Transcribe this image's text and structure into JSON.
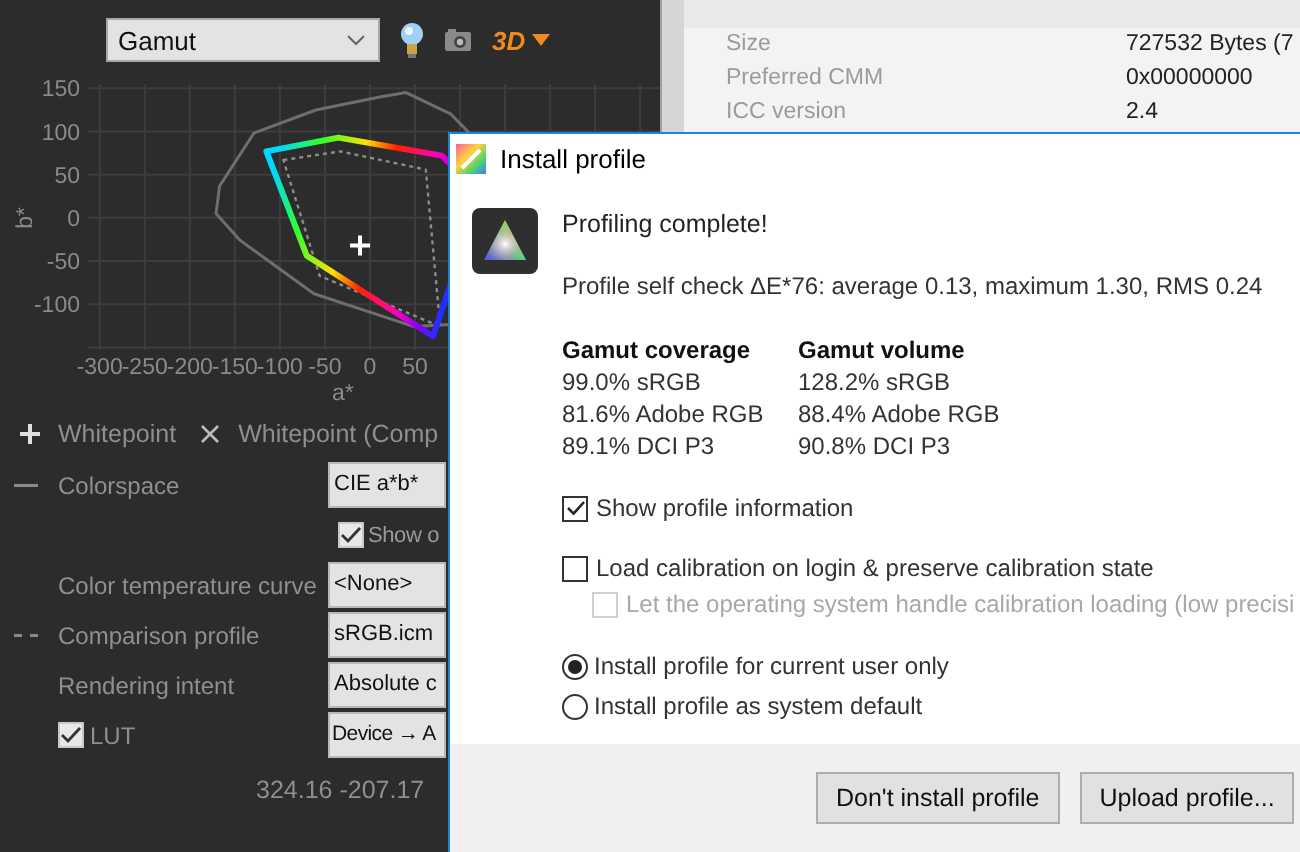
{
  "toolbar": {
    "view_select": {
      "value": "Gamut"
    },
    "mode_label": "3D"
  },
  "gamut_plot": {
    "x_axis_label": "a*",
    "y_axis_label": "b*",
    "x_tick_labels": [
      "-300",
      "-250",
      "-200",
      "-150",
      "-100",
      "-50",
      "0",
      "50"
    ],
    "y_tick_labels": [
      "150",
      "100",
      "50",
      "0",
      "-50",
      "-100"
    ]
  },
  "legend": [
    {
      "kind": "plus",
      "label": "Whitepoint"
    },
    {
      "kind": "cross",
      "label": "Whitepoint (Comp"
    }
  ],
  "settings": [
    {
      "kind": "dropdown",
      "label": "Colorspace",
      "line_marker": true,
      "dashed": false,
      "value": "CIE a*b*"
    },
    {
      "kind": "checkbox",
      "label": "Show o",
      "checked": true
    },
    {
      "kind": "dropdown",
      "label": "Color temperature curve",
      "value": "<None>"
    },
    {
      "kind": "dropdown",
      "label": "Comparison profile",
      "line_marker": true,
      "dashed": true,
      "value": "sRGB.icm"
    },
    {
      "kind": "dropdown",
      "label": "Rendering intent",
      "value": "Absolute c"
    },
    {
      "kind": "checkbox-dropdown",
      "label": "LUT",
      "checked": true,
      "value": "Device → A"
    }
  ],
  "cursor_readout": "324.16 -207.17",
  "profile_info": [
    {
      "name": "Size",
      "value": "727532 Bytes (7"
    },
    {
      "name": "Preferred CMM",
      "value": "0x00000000"
    },
    {
      "name": "ICC version",
      "value": "2.4"
    }
  ],
  "dialog": {
    "title": "Install profile",
    "heading": "Profiling complete!",
    "self_check": "Profile self check ΔE*76: average 0.13, maximum 1.30, RMS 0.24",
    "gamut_columns": [
      {
        "title": "Gamut coverage",
        "rows": [
          "99.0% sRGB",
          "81.6% Adobe RGB",
          "89.1% DCI P3"
        ]
      },
      {
        "title": "Gamut volume",
        "rows": [
          "128.2% sRGB",
          "88.4% Adobe RGB",
          "90.8% DCI P3"
        ]
      }
    ],
    "options": [
      {
        "label": "Show profile information",
        "checked": true,
        "disabled": false
      },
      {
        "label": "Load calibration on login & preserve calibration state",
        "checked": false,
        "disabled": false,
        "children": [
          {
            "label": "Let the operating system handle calibration loading (low precisi",
            "checked": false,
            "disabled": true
          }
        ]
      }
    ],
    "install_scope": [
      {
        "label": "Install profile for current user only",
        "selected": true
      },
      {
        "label": "Install profile as system default",
        "selected": false
      }
    ],
    "buttons": [
      "Don't install profile",
      "Upload profile..."
    ]
  }
}
